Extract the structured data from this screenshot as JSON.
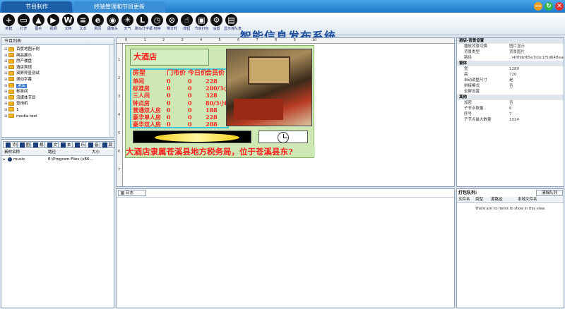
{
  "titlebar": {
    "tabs": [
      "节目制作",
      "终端管理和节目更新"
    ],
    "window_buttons": [
      "—",
      "↻",
      "✕"
    ]
  },
  "toolbar": {
    "items": [
      {
        "icon": "plus-icon",
        "glyph": "+",
        "label": "新建"
      },
      {
        "icon": "folder-open-icon",
        "glyph": "▭",
        "label": "打开"
      },
      {
        "icon": "image-icon",
        "glyph": "▲",
        "label": "图片"
      },
      {
        "icon": "video-icon",
        "glyph": "▶",
        "label": "视频"
      },
      {
        "icon": "word-icon",
        "glyph": "W",
        "label": "文档"
      },
      {
        "icon": "text-icon",
        "glyph": "≡",
        "label": "文本"
      },
      {
        "icon": "web-icon",
        "glyph": "e",
        "label": "网页"
      },
      {
        "icon": "camera-icon",
        "glyph": "◉",
        "label": "摄像头"
      },
      {
        "icon": "weather-icon",
        "glyph": "☀",
        "label": "天气"
      },
      {
        "icon": "led-icon",
        "glyph": "L",
        "label": "跑马灯字幕"
      },
      {
        "icon": "clock-icon",
        "glyph": "◷",
        "label": "时钟"
      },
      {
        "icon": "count-icon",
        "glyph": "⊙",
        "label": "倒计时"
      },
      {
        "icon": "touch-icon",
        "glyph": "☝",
        "label": "按钮"
      },
      {
        "icon": "package-icon",
        "glyph": "▣",
        "label": "节目打包"
      },
      {
        "icon": "gear-icon",
        "glyph": "⚙",
        "label": "设置"
      },
      {
        "icon": "publish-icon",
        "glyph": "▤",
        "label": "显示排队表"
      }
    ],
    "app_title": "智能信息发布系统"
  },
  "left_tree": {
    "header": "节目列表",
    "items": [
      "百度地图示例",
      "商品展示",
      "房产楼盘",
      "酒店宾馆",
      "双屏异显测试",
      "滚动字幕",
      "酒店",
      "标准间",
      "流媒体节目",
      "查询机",
      "1",
      "media test"
    ],
    "selected_index": 6
  },
  "file_panel": {
    "tabs": [
      "背景",
      "图",
      "视",
      "文",
      "本",
      "乐",
      "音",
      "其"
    ],
    "columns": [
      "素材名称",
      "路径",
      "大小"
    ],
    "rows": [
      {
        "name": "music",
        "path": "E:\\Program Files (x86...",
        "size": ""
      }
    ]
  },
  "canvas": {
    "hotel_title": "大酒店",
    "price_header": [
      "房型",
      "门市价",
      "今日价",
      "会员价"
    ],
    "rows": [
      [
        "单间",
        "0",
        "0",
        "228"
      ],
      [
        "标准房",
        "0",
        "0",
        "280/3小时"
      ],
      [
        "三人间",
        "0",
        "0",
        "328"
      ],
      [
        "钟点房",
        "0",
        "0",
        "80/3小时"
      ],
      [
        "普通双人房",
        "0",
        "0",
        "188"
      ],
      [
        "豪华单人房",
        "0",
        "0",
        "228"
      ],
      [
        "豪华双人房",
        "0",
        "0",
        "288"
      ]
    ],
    "marquee": "大酒店隶属苍溪县地方税务局，位于苍溪县东?",
    "ruler_numbers": [
      "0",
      "1",
      "2",
      "3",
      "4",
      "5",
      "6",
      "7",
      "8",
      "9",
      "10"
    ],
    "vruler_numbers": [
      "1",
      "2",
      "3",
      "4",
      "5",
      "6",
      "7"
    ]
  },
  "log_panel": {
    "tab": "日志"
  },
  "properties": {
    "sections": [
      {
        "title": "酒店-背景设置",
        "rows": [
          [
            "播放背景切换",
            "图片显示"
          ],
          [
            "背景类型",
            "背景图片"
          ],
          [
            "路径",
            "..\\4f89bf65e7cbc1f5d648eaa88acce4e90f24..."
          ]
        ]
      },
      {
        "title": "窗体",
        "rows": [
          [
            "宽",
            "1280"
          ],
          [
            "高",
            "720"
          ],
          [
            "自动调整尺寸",
            "是"
          ],
          [
            "拼接模式",
            "否"
          ],
          [
            "全屏设置",
            ""
          ]
        ]
      },
      {
        "title": "其他",
        "rows": [
          [
            "加密",
            "否"
          ],
          [
            "子节点数量",
            "6"
          ],
          [
            "序号",
            "7"
          ],
          [
            "子节点最大数量",
            "1024"
          ]
        ]
      }
    ]
  },
  "queue_panel": {
    "title": "打包队列:",
    "clear_button": "清除队列",
    "columns": [
      "文件名",
      "类型",
      "源路径",
      "本地文件名"
    ],
    "empty_text": "There are no items to show in this view."
  }
}
